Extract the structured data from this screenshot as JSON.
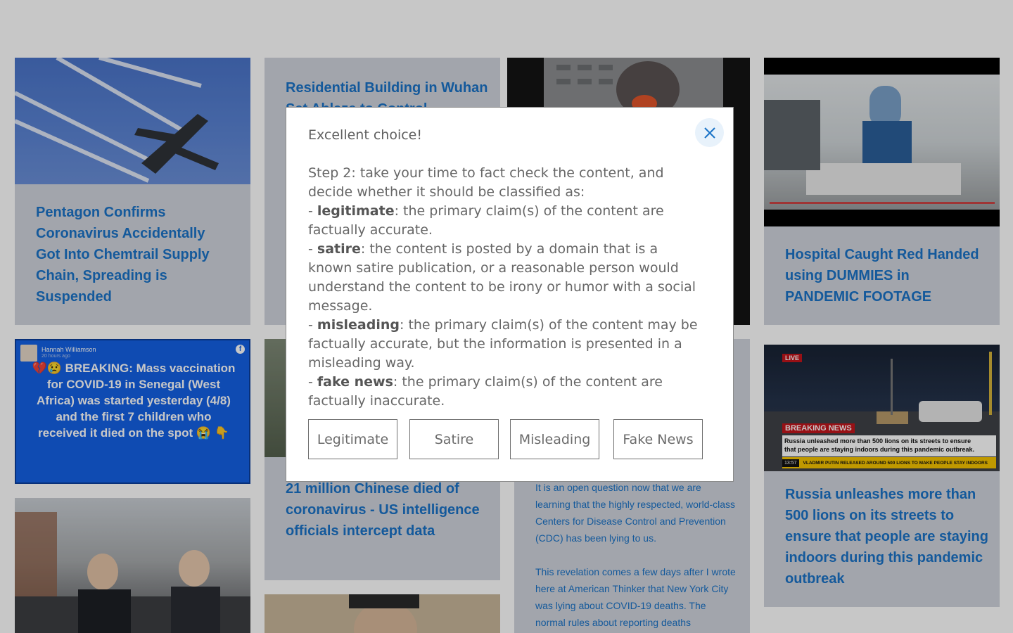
{
  "cards": {
    "chemtrail": {
      "title": "Pentagon Confirms Coronavirus Accidentally Got Into Chemtrail Supply Chain, Spreading is Suspended"
    },
    "wuhan": {
      "title": "Residential Building in Wuhan Set Ablaze to Control"
    },
    "hospital": {
      "title": "Hospital Caught Red Handed using DUMMIES in PANDEMIC FOOTAGE"
    },
    "senegal": {
      "author": "Hannah Williamson",
      "time": "20 hours ago",
      "post_text": "💔😢 BREAKING: Mass vaccination for COVID-19 in Senegal (West Africa) was started yesterday (4/8) and the first 7 children who received it died on the spot 😭 👇"
    },
    "china_deaths": {
      "title": "21 million Chinese died of coronavirus - US intelligence officials intercept data"
    },
    "cdc": {
      "body": "It is an open question now that we are learning that the highly respected, world-class Centers for Disease Control and Prevention (CDC) has been lying to us.\n\nThis revelation comes a few days after I wrote here at American Thinker that New York City was lying about COVID-19 deaths. The normal rules about reporting deaths"
    },
    "lions": {
      "live_badge": "LIVE",
      "breaking_label": "BREAKING NEWS",
      "breaking_line1": "Russia unleashed more than 500 lions on its streets to ensure",
      "breaking_line2": "that people are staying indoors during this pandemic outbreak.",
      "ticker_time": "13:57",
      "ticker_text": "VLADMIR PUTIN RELEASED AROUND 500 LIONS TO MAKE PEOPLE STAY INDOORS",
      "title": "Russia unleashes more than 500 lions on its streets to ensure that people are staying indoors during this pandemic outbreak"
    }
  },
  "modal": {
    "heading": "Excellent choice!",
    "intro": "Step 2: take your time to fact check the content, and decide whether it should be classified as:",
    "items": [
      {
        "term": "legitimate",
        "desc": ": the primary claim(s) of the content are factually accurate."
      },
      {
        "term": "satire",
        "desc": ": the content is posted by a domain that is a known satire publication, or a reasonable person would understand the content to be irony or humor with a social message."
      },
      {
        "term": "misleading",
        "desc": ": the primary claim(s) of the content may be factually accurate, but the information is presented in a misleading way."
      },
      {
        "term": "fake news",
        "desc": ": the primary claim(s) of the content are factually inaccurate."
      }
    ],
    "buttons": {
      "legitimate": "Legitimate",
      "satire": "Satire",
      "misleading": "Misleading",
      "fake_news": "Fake News"
    }
  },
  "colors": {
    "card_bg": "#d0d4dd",
    "title_blue": "#1a73c7",
    "modal_close_bg": "#e8f2fb"
  }
}
